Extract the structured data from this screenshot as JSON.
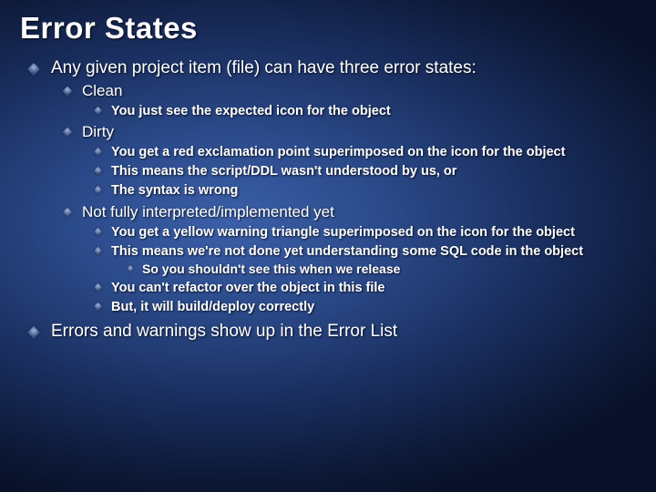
{
  "title": "Error States",
  "bullets": {
    "b1": "Any given project item (file) can have three error states:",
    "b1_1": "Clean",
    "b1_1_1": "You just see the expected icon for the object",
    "b1_2": "Dirty",
    "b1_2_1": "You get a red exclamation point superimposed on the icon for the object",
    "b1_2_2": "This means the script/DDL wasn't understood by us, or",
    "b1_2_3": "The syntax is wrong",
    "b1_3": "Not fully interpreted/implemented yet",
    "b1_3_1": "You get a yellow warning triangle superimposed on the icon for the object",
    "b1_3_2": "This means we're not done yet understanding some SQL code in the object",
    "b1_3_2_1": "So you shouldn't see this when we release",
    "b1_3_3": "You can't refactor over the object in this file",
    "b1_3_4": "But, it will build/deploy correctly",
    "b2": "Errors and warnings show up in the Error List"
  }
}
